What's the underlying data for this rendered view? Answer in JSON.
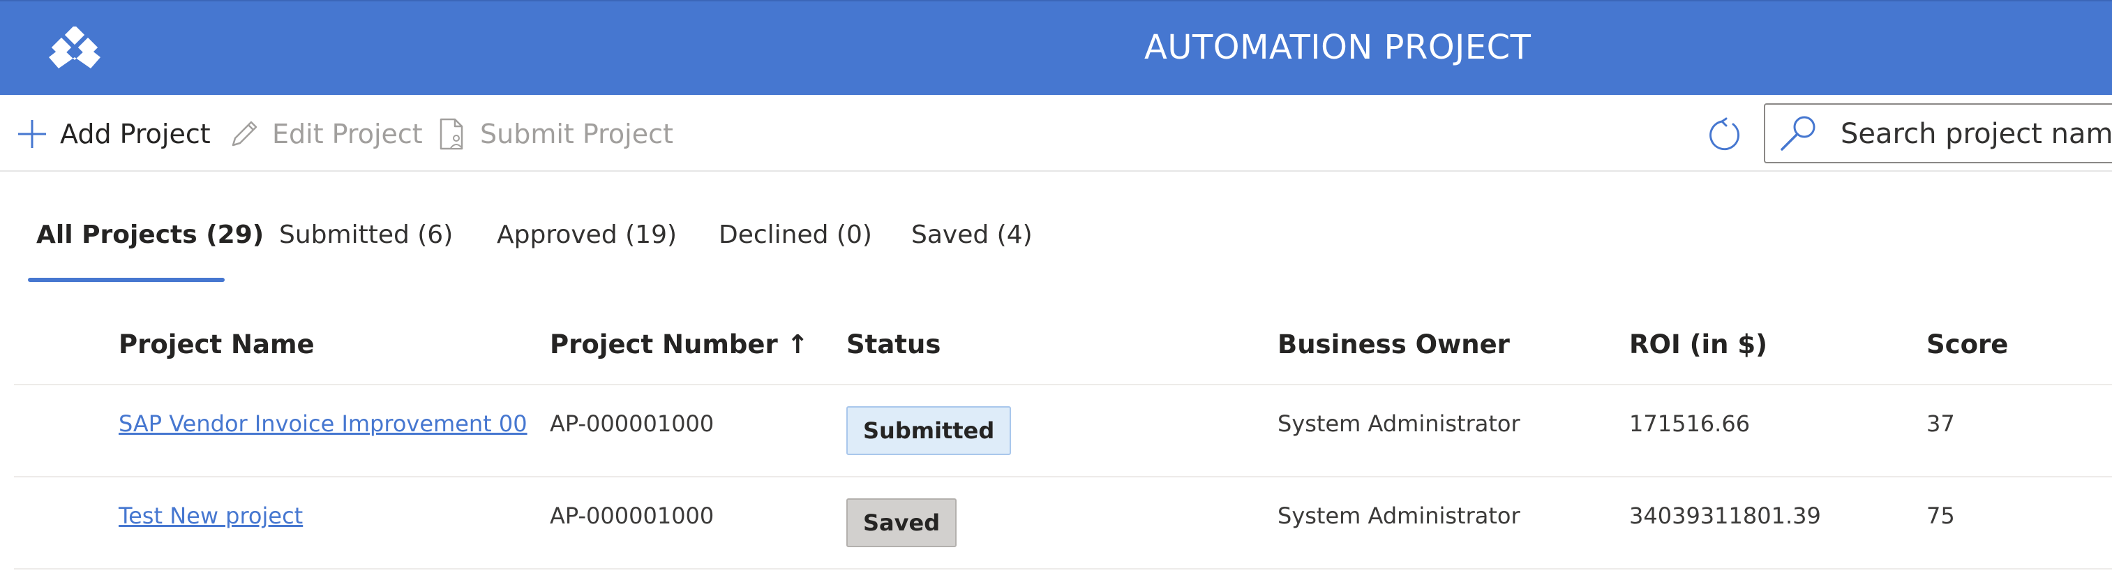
{
  "app": {
    "title": "AUTOMATION PROJECT"
  },
  "toolbar": {
    "add_label": "Add Project",
    "edit_label": "Edit Project",
    "submit_label": "Submit Project",
    "search_placeholder": "Search project name"
  },
  "tabs": [
    {
      "label": "All Projects (29)",
      "active": true
    },
    {
      "label": "Submitted (6)",
      "active": false
    },
    {
      "label": "Approved (19)",
      "active": false
    },
    {
      "label": "Declined (0)",
      "active": false
    },
    {
      "label": "Saved (4)",
      "active": false
    }
  ],
  "grid": {
    "columns": [
      "Project Name",
      "Project Number ↑",
      "Status",
      "Business Owner",
      "ROI (in $)",
      "Score"
    ],
    "rows": [
      {
        "name": "SAP Vendor Invoice Improvement 00",
        "number": "AP-000001000",
        "status": "Submitted",
        "owner": "System Administrator",
        "roi": "171516.66",
        "score": "37"
      },
      {
        "name": "Test New project",
        "number": "AP-000001000",
        "status": "Saved",
        "owner": "System Administrator",
        "roi": "34039311801.39",
        "score": "75"
      }
    ]
  },
  "colors": {
    "header": "#4677d0",
    "link": "#4677d0",
    "submitted_badge": "#deecf9",
    "saved_badge": "#d2d0ce"
  }
}
